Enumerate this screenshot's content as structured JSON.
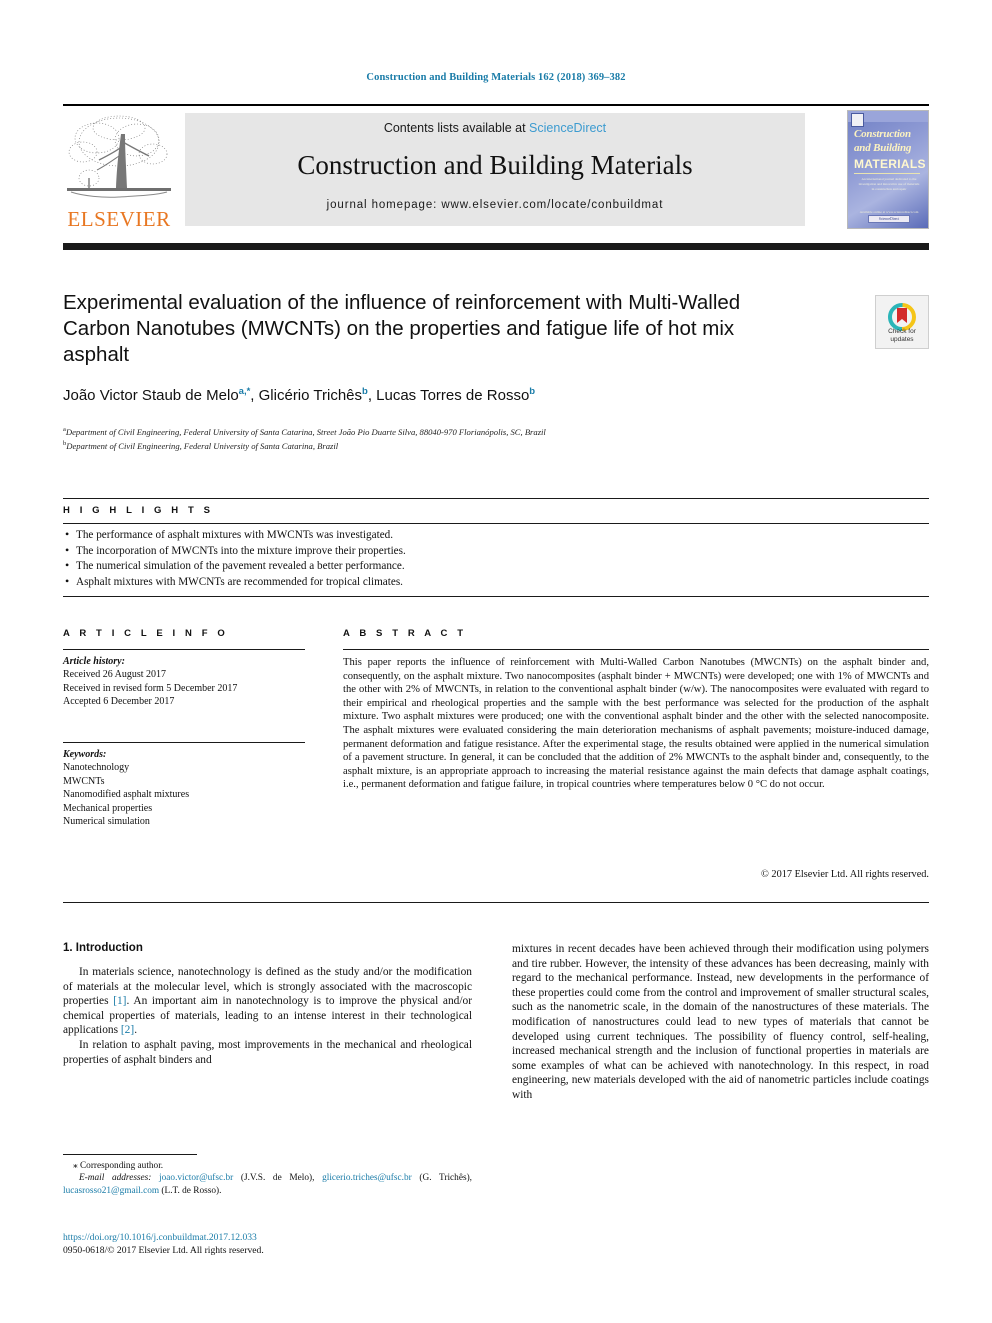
{
  "running_head": "Construction and Building Materials 162 (2018) 369–382",
  "masthead": {
    "publisher": "ELSEVIER",
    "contents_prefix": "Contents lists available at ",
    "contents_link": "ScienceDirect",
    "journal_title": "Construction and Building Materials",
    "homepage": "journal homepage: www.elsevier.com/locate/conbuildmat",
    "cover": {
      "line1": "Construction",
      "line2": "and Building",
      "line3": "MATERIALS",
      "blurb": "An international journal dedicated to the investigation and innovative use of materials in construction and repair",
      "footer_badge": "ScienceDirect",
      "footer_label": "Available online at www.sciencedirect.com"
    }
  },
  "article": {
    "title": "Experimental evaluation of the influence of reinforcement with Multi-Walled Carbon Nanotubes (MWCNTs) on the properties and fatigue life of hot mix asphalt",
    "crossmark_line1": "Check for",
    "crossmark_line2": "updates",
    "authors": [
      {
        "name": "João Victor Staub de Melo",
        "marks": "a,*"
      },
      {
        "name": "Glicério Trichês",
        "marks": "b"
      },
      {
        "name": "Lucas Torres de Rosso",
        "marks": "b"
      }
    ],
    "affiliations": [
      {
        "mark": "a",
        "text": "Department of Civil Engineering, Federal University of Santa Catarina, Street João Pio Duarte Silva, 88040-970 Florianópolis, SC, Brazil"
      },
      {
        "mark": "b",
        "text": "Department of Civil Engineering, Federal University of Santa Catarina, Brazil"
      }
    ]
  },
  "highlights": {
    "label": "H I G H L I G H T S",
    "items": [
      "The performance of asphalt mixtures with MWCNTs was investigated.",
      "The incorporation of MWCNTs into the mixture improve their properties.",
      "The numerical simulation of the pavement revealed a better performance.",
      "Asphalt mixtures with MWCNTs are recommended for tropical climates."
    ]
  },
  "article_info": {
    "label": "A R T I C L E  I N F O",
    "history_heading": "Article history:",
    "history": [
      "Received 26 August 2017",
      "Received in revised form 5 December 2017",
      "Accepted 6 December 2017"
    ],
    "keywords_heading": "Keywords:",
    "keywords": [
      "Nanotechnology",
      "MWCNTs",
      "Nanomodified asphalt mixtures",
      "Mechanical properties",
      "Numerical simulation"
    ]
  },
  "abstract": {
    "label": "A B S T R A C T",
    "text": "This paper reports the influence of reinforcement with Multi-Walled Carbon Nanotubes (MWCNTs) on the asphalt binder and, consequently, on the asphalt mixture. Two nanocomposites (asphalt binder + MWCNTs) were developed; one with 1% of MWCNTs and the other with 2% of MWCNTs, in relation to the conventional asphalt binder (w/w). The nanocomposites were evaluated with regard to their empirical and rheological properties and the sample with the best performance was selected for the production of the asphalt mixture. Two asphalt mixtures were produced; one with the conventional asphalt binder and the other with the selected nanocomposite. The asphalt mixtures were evaluated considering the main deterioration mechanisms of asphalt pavements; moisture-induced damage, permanent deformation and fatigue resistance. After the experimental stage, the results obtained were applied in the numerical simulation of a pavement structure. In general, it can be concluded that the addition of 2% MWCNTs to the asphalt binder and, consequently, to the asphalt mixture, is an appropriate approach to increasing the material resistance against the main defects that damage asphalt coatings, i.e., permanent deformation and fatigue failure, in tropical countries where temperatures below 0 °C do not occur.",
    "copyright": "© 2017 Elsevier Ltd. All rights reserved."
  },
  "body": {
    "section_heading": "1. Introduction",
    "left_paragraph_1_a": "In materials science, nanotechnology is defined as the study and/or the modification of materials at the molecular level, which is strongly associated with the macroscopic properties ",
    "left_paragraph_1_ref1": "[1]",
    "left_paragraph_1_b": ". An important aim in nanotechnology is to improve the physical and/or chemical properties of materials, leading to an intense interest in their technological applications ",
    "left_paragraph_1_ref2": "[2]",
    "left_paragraph_1_c": ".",
    "left_paragraph_2": "In relation to asphalt paving, most improvements in the mechanical and rheological properties of asphalt binders and",
    "right_paragraph_1": "mixtures in recent decades have been achieved through their modification using polymers and tire rubber. However, the intensity of these advances has been decreasing, mainly with regard to the mechanical performance. Instead, new developments in the performance of these properties could come from the control and improvement of smaller structural scales, such as the nanometric scale, in the domain of the nanostructures of these materials. The modification of nanostructures could lead to new types of materials that cannot be developed using current techniques. The possibility of fluency control, self-healing, increased mechanical strength and the inclusion of functional properties in materials are some examples of what can be achieved with nanotechnology. In this respect, in road engineering, new materials developed with the aid of nanometric particles include coatings with"
  },
  "footnotes": {
    "corresponding": "⁎ Corresponding author.",
    "email_label": "E-mail addresses:",
    "email1": "joao.victor@ufsc.br",
    "email1_owner": "(J.V.S. de Melo),",
    "email2": "glicerio.triches@ufsc.br",
    "email2_owner": "(G. Trichês),",
    "email3": "lucasrosso21@gmail.com",
    "email3_owner": "(L.T. de Rosso).",
    "doi": "https://doi.org/10.1016/j.conbuildmat.2017.12.033",
    "issn_copyright": "0950-0618/© 2017 Elsevier Ltd. All rights reserved."
  },
  "colors": {
    "link": "#1a7ca8",
    "sciencedirect": "#3c9bd0",
    "elsevier_orange": "#E87722",
    "band_gray": "#e6e6e6"
  }
}
